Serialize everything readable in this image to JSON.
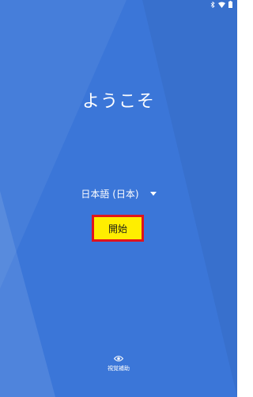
{
  "status_bar": {
    "icons": [
      "bluetooth-icon",
      "wifi-icon",
      "battery-icon"
    ]
  },
  "welcome": {
    "title": "ようこそ"
  },
  "language": {
    "selected": "日本語 (日本)"
  },
  "start_button": {
    "label": "開始"
  },
  "accessibility": {
    "label": "視覚補助",
    "icon": "eye-icon"
  },
  "colors": {
    "background": "#3b76d8",
    "button_bg": "#ffee00",
    "button_border": "#e0141c"
  }
}
